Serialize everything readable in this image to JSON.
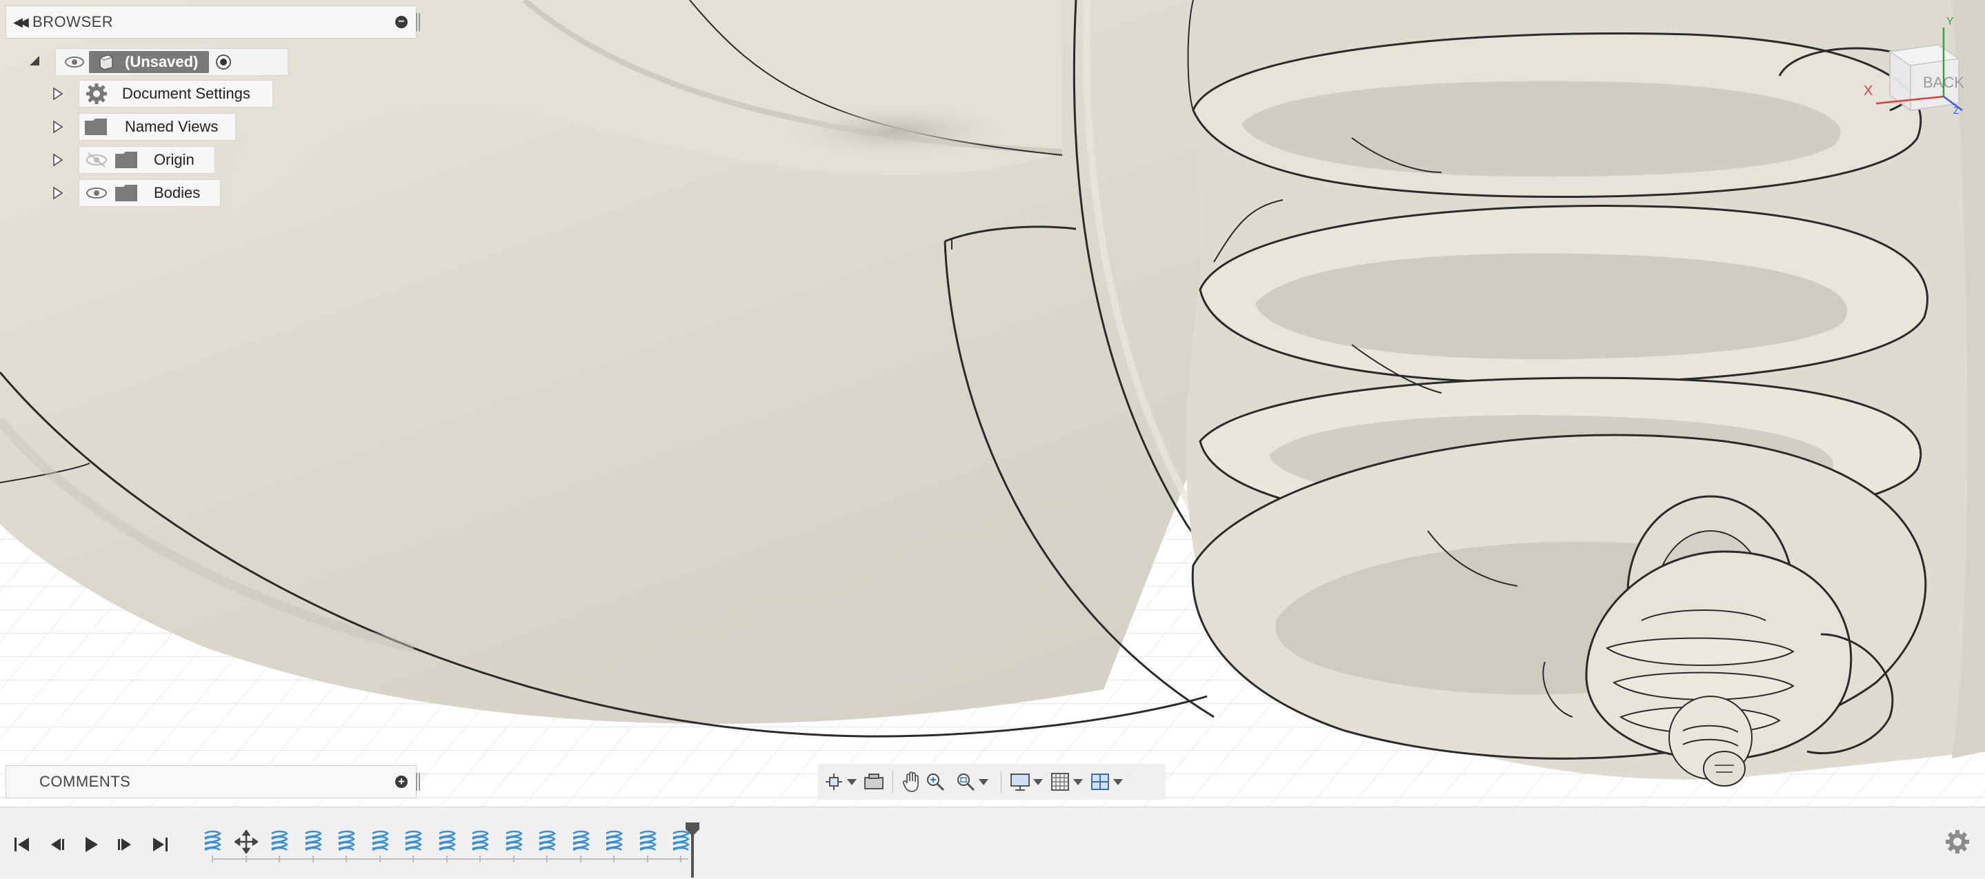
{
  "browser": {
    "title": "BROWSER",
    "root_label": "(Unsaved)",
    "items": [
      {
        "label": "Document Settings",
        "icon": "gear-icon"
      },
      {
        "label": "Named Views",
        "icon": "folder-icon"
      },
      {
        "label": "Origin",
        "icon": "folder-icon",
        "visibility": "hidden"
      },
      {
        "label": "Bodies",
        "icon": "folder-icon",
        "visibility": "visible"
      }
    ]
  },
  "comments": {
    "title": "COMMENTS"
  },
  "viewcube": {
    "face_label": "BACK",
    "axes": [
      "X",
      "Y",
      "Z"
    ]
  },
  "navigation_toolbar": {
    "tools": [
      "orbit-icon",
      "look-at-icon",
      "pan-hand-icon",
      "zoom-icon",
      "zoom-window-icon",
      "display-settings-icon",
      "grid-settings-icon",
      "viewports-icon"
    ]
  },
  "timeline": {
    "controls": [
      "go-to-start",
      "step-back",
      "play",
      "step-forward",
      "go-to-end"
    ],
    "features": [
      "coil",
      "move",
      "coil",
      "coil",
      "coil",
      "coil",
      "coil",
      "coil",
      "coil",
      "coil",
      "coil",
      "coil",
      "coil",
      "coil",
      "coil"
    ]
  },
  "colors": {
    "model_surface": "#dcd9ce",
    "background": "#ffffff",
    "grid": "#cfd3d6",
    "coil_feature": "#3b8fd6",
    "accent": "#1b7fd1"
  }
}
